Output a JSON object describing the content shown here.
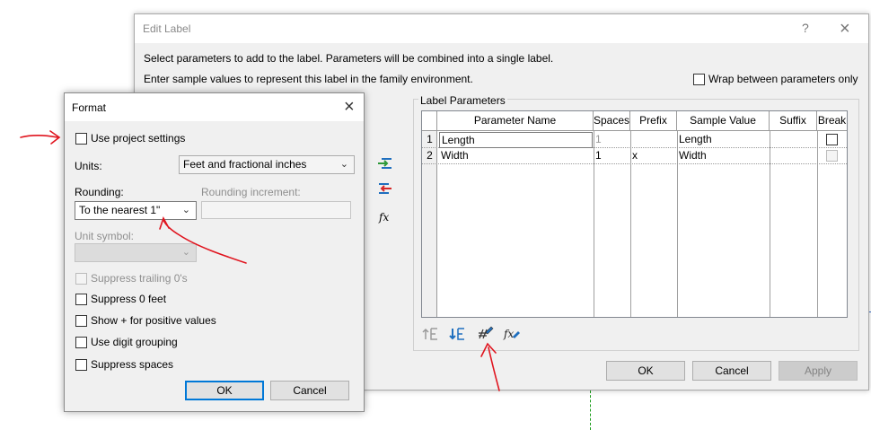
{
  "edit_label": {
    "title": "Edit Label",
    "help": "?",
    "close": "×",
    "instruction_1": "Select parameters to add to the label.  Parameters will be combined into a single label.",
    "instruction_2": "Enter sample values to represent this label in the family environment.",
    "wrap_label": "Wrap between parameters only",
    "group_title": "Label Parameters",
    "columns": [
      "Parameter Name",
      "Spaces",
      "Prefix",
      "Sample Value",
      "Suffix",
      "Break"
    ],
    "rows": [
      {
        "num": "1",
        "name": "Length",
        "spaces": "1",
        "prefix": "",
        "sample": "Length",
        "suffix": ""
      },
      {
        "num": "2",
        "name": "Width",
        "spaces": "1",
        "prefix": "x",
        "sample": "Width",
        "suffix": ""
      }
    ],
    "fx": "fx",
    "ok": "OK",
    "cancel": "Cancel",
    "apply": "Apply"
  },
  "format": {
    "title": "Format",
    "close": "×",
    "use_project_settings": "Use project settings",
    "units_label": "Units:",
    "units_value": "Feet and fractional inches",
    "rounding_label": "Rounding:",
    "rounding_value": "To the nearest 1\"",
    "rounding_increment_label": "Rounding increment:",
    "unit_symbol_label": "Unit symbol:",
    "suppress_trailing": "Suppress trailing 0's",
    "suppress_0_feet": "Suppress 0 feet",
    "show_plus": "Show + for positive values",
    "digit_grouping": "Use digit grouping",
    "suppress_spaces": "Suppress spaces",
    "ok": "OK",
    "cancel": "Cancel"
  },
  "colors": {
    "accent": "#0078d7",
    "annotation": "#e0141e",
    "add_arrow": "#2f9a3a",
    "remove_arrow": "#d62828",
    "icon_blue": "#1f6fbf"
  }
}
